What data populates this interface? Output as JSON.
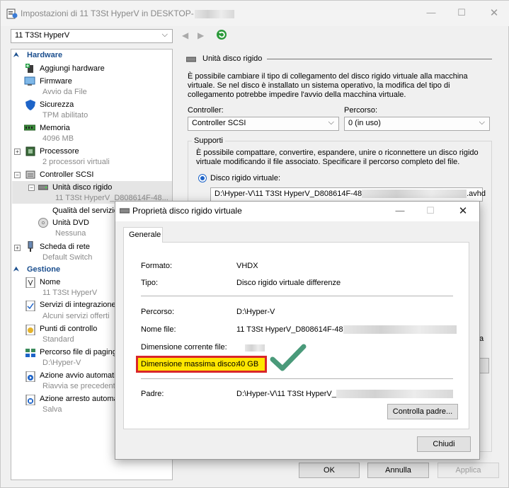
{
  "window": {
    "title": "Impostazioni di 11 T3St HyperV in DESKTOP-",
    "min": "—",
    "max": "☐",
    "close": "✕"
  },
  "vm_selector": {
    "value": "11 T3St HyperV"
  },
  "tree": {
    "hardware_header": "Hardware",
    "management_header": "Gestione",
    "items": [
      {
        "label": "Aggiungi hardware",
        "sub": ""
      },
      {
        "label": "Firmware",
        "sub": "Avvio da File"
      },
      {
        "label": "Sicurezza",
        "sub": "TPM abilitato"
      },
      {
        "label": "Memoria",
        "sub": "4096 MB"
      },
      {
        "label": "Processore",
        "sub": "2 processori virtuali"
      },
      {
        "label": "Controller SCSI",
        "sub": ""
      },
      {
        "label": "Unità disco rigido",
        "sub": "11 T3St HyperV_D808614F-48..."
      },
      {
        "label": "Qualità del servizio",
        "sub": ""
      },
      {
        "label": "Unità DVD",
        "sub": "Nessuna"
      },
      {
        "label": "Scheda di rete",
        "sub": "Default Switch"
      },
      {
        "label": "Nome",
        "sub": "11 T3St HyperV"
      },
      {
        "label": "Servizi di integrazione",
        "sub": "Alcuni servizi offerti"
      },
      {
        "label": "Punti di controllo",
        "sub": "Standard"
      },
      {
        "label": "Percorso file di paging",
        "sub": "D:\\Hyper-V"
      },
      {
        "label": "Azione avvio automatico",
        "sub": "Riavvia se precedente..."
      },
      {
        "label": "Azione arresto automatico",
        "sub": "Salva"
      }
    ]
  },
  "detail": {
    "heading": "Unità disco rigido",
    "description": "È possibile cambiare il tipo di collegamento del disco rigido virtuale alla macchina virtuale. Se nel disco è installato un sistema operativo, la modifica del tipo di collegamento potrebbe impedire l'avvio della macchina virtuale.",
    "controller_label": "Controller:",
    "controller_value": "Controller SCSI",
    "location_label": "Percorso:",
    "location_value": "0 (in uso)",
    "media_label": "Supporti",
    "media_description": "È possibile compattare, convertire, espandere, unire o riconnettere un disco rigido virtuale modificando il file associato. Specificare il percorso completo del file.",
    "vhd_radio_label": "Disco rigido virtuale:",
    "vhd_path_start": "D:\\Hyper-V\\11 T3St HyperV_D808614F-48",
    "vhd_path_end": ".avhd",
    "partial_char": "a"
  },
  "dialog": {
    "title": "Proprietà disco rigido virtuale",
    "min": "—",
    "max": "☐",
    "close": "✕",
    "tab": "Generale",
    "format_label": "Formato:",
    "format_value": "VHDX",
    "type_label": "Tipo:",
    "type_value": "Disco rigido virtuale differenze",
    "path_label": "Percorso:",
    "path_value": "D:\\Hyper-V",
    "filename_label": "Nome file:",
    "filename_value": "11 T3St HyperV_D808614F-48",
    "current_size_label": "Dimensione corrente file:",
    "max_size_label": "Dimensione massima disco:",
    "max_size_value": "40 GB",
    "parent_label": "Padre:",
    "parent_value": "D:\\Hyper-V\\11 T3St HyperV_",
    "check_parent_button": "Controlla padre...",
    "close_button": "Chiudi"
  },
  "footer": {
    "ok": "OK",
    "cancel": "Annulla",
    "apply": "Applica"
  },
  "colors": {
    "accent": "#1a4e8e",
    "highlight_box": "#d9262b",
    "highlight_fill": "#ffe600",
    "check": "#4a9a7a"
  }
}
